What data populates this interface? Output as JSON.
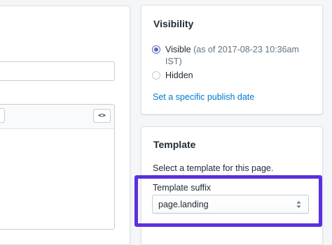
{
  "editor": {
    "html_toggle_label": "<>"
  },
  "visibility": {
    "title": "Visibility",
    "options": [
      {
        "label": "Visible",
        "detail": "(as of 2017-08-23 10:36am IST)",
        "checked": true
      },
      {
        "label": "Hidden",
        "detail": "",
        "checked": false
      }
    ],
    "publish_link": "Set a specific publish date"
  },
  "template": {
    "title": "Template",
    "description": "Select a template for this page.",
    "suffix_label": "Template suffix",
    "suffix_value": "page.landing"
  },
  "colors": {
    "accent": "#5c6ac4",
    "link": "#007ace",
    "highlight": "#5b2fe0"
  }
}
